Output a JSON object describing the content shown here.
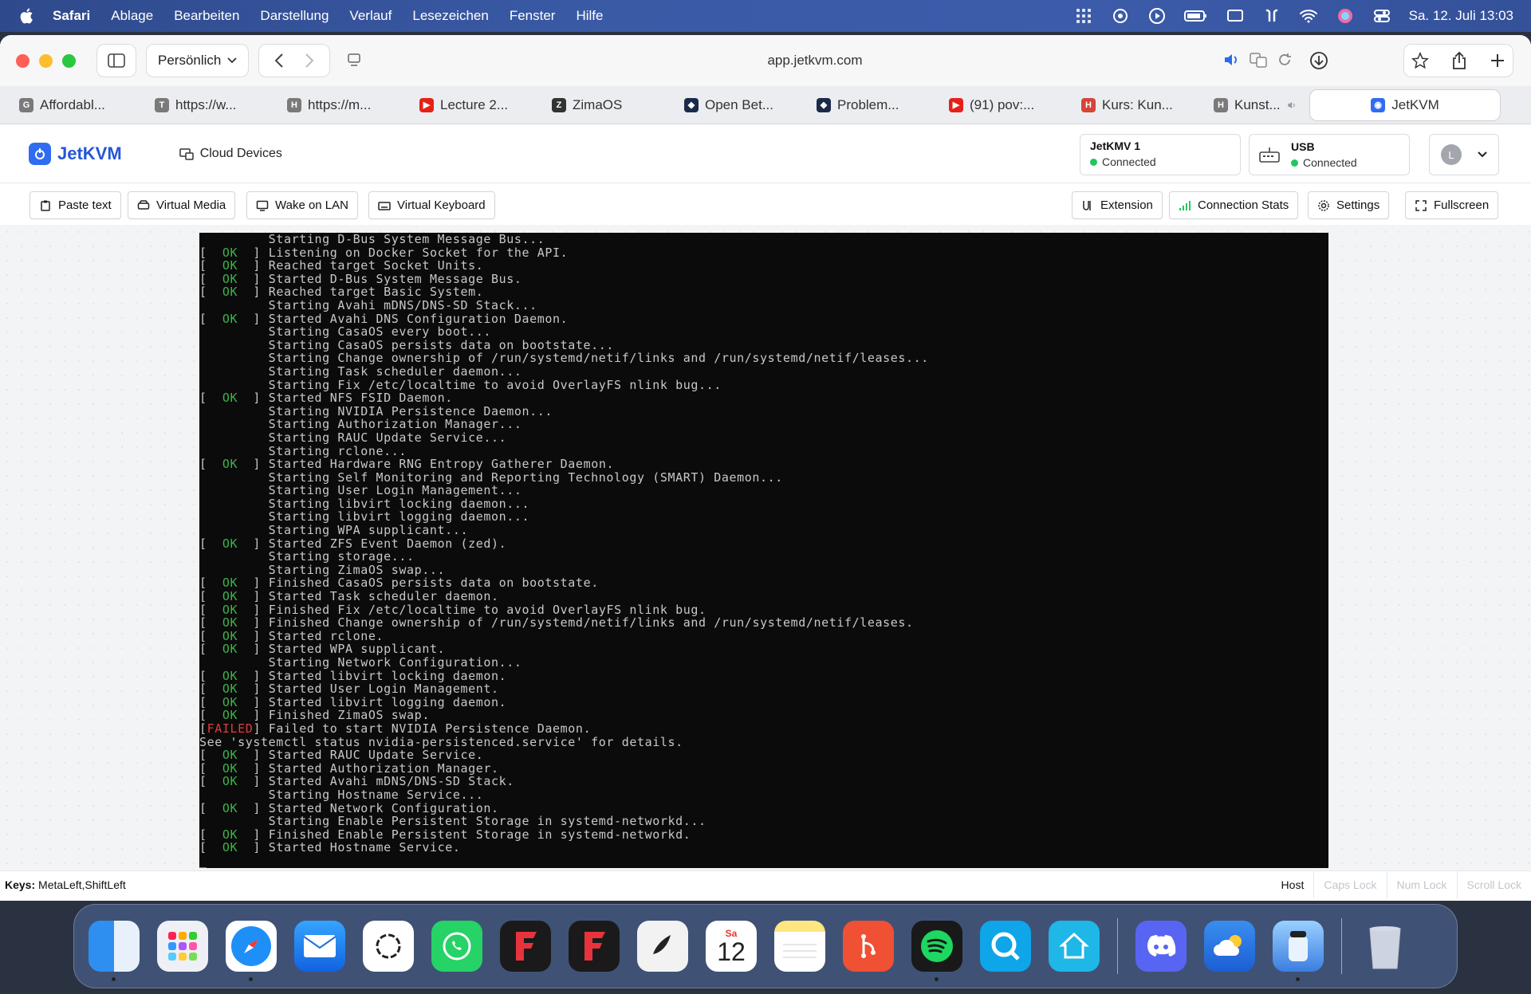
{
  "menubar": {
    "app": "Safari",
    "items": [
      "Ablage",
      "Bearbeiten",
      "Darstellung",
      "Verlauf",
      "Lesezeichen",
      "Fenster",
      "Hilfe"
    ],
    "clock": "Sa. 12. Juli  13:03"
  },
  "browser": {
    "profile": "Persönlich",
    "url": "app.jetkvm.com",
    "tabs": [
      {
        "label": "Affordabl...",
        "fav": "G",
        "color": "#7a7a7a"
      },
      {
        "label": "https://w...",
        "fav": "T",
        "color": "#7a7a7a"
      },
      {
        "label": "https://m...",
        "fav": "H",
        "color": "#7a7a7a"
      },
      {
        "label": "Lecture 2...",
        "fav": "▶",
        "color": "#e62117"
      },
      {
        "label": "ZimaOS",
        "fav": "Z",
        "color": "#333333"
      },
      {
        "label": "Open Bet...",
        "fav": "◆",
        "color": "#1c2a4a"
      },
      {
        "label": "Problem...",
        "fav": "◆",
        "color": "#1c2a4a"
      },
      {
        "label": "(91) pov:...",
        "fav": "▶",
        "color": "#e62117"
      },
      {
        "label": "Kurs: Kun...",
        "fav": "H",
        "color": "#d4453a"
      },
      {
        "label": "Kunst...",
        "fav": "H",
        "color": "#7a7a7a"
      },
      {
        "label": "JetKVM",
        "fav": "◉",
        "color": "#2f6cf0"
      }
    ]
  },
  "app": {
    "logo": "JetKVM",
    "cloud_devices": "Cloud Devices",
    "device": {
      "title": "JetKMV 1",
      "status": "Connected"
    },
    "usb": {
      "title": "USB",
      "status": "Connected"
    },
    "avatar": "L",
    "actions_left": [
      "Paste text",
      "Virtual Media",
      "Wake on LAN",
      "Virtual Keyboard"
    ],
    "actions_right": [
      "Extension",
      "Connection Stats",
      "Settings",
      "Fullscreen"
    ]
  },
  "console": {
    "lines": [
      {
        "tag": "",
        "text": "         Starting D-Bus System Message Bus..."
      },
      {
        "tag": "OK",
        "text": "Listening on Docker Socket for the API."
      },
      {
        "tag": "OK",
        "text": "Reached target Socket Units."
      },
      {
        "tag": "OK",
        "text": "Started D-Bus System Message Bus."
      },
      {
        "tag": "OK",
        "text": "Reached target Basic System."
      },
      {
        "tag": "",
        "text": "         Starting Avahi mDNS/DNS-SD Stack..."
      },
      {
        "tag": "OK",
        "text": "Started Avahi DNS Configuration Daemon."
      },
      {
        "tag": "",
        "text": "         Starting CasaOS every boot..."
      },
      {
        "tag": "",
        "text": "         Starting CasaOS persists data on bootstate..."
      },
      {
        "tag": "",
        "text": "         Starting Change ownership of /run/systemd/netif/links and /run/systemd/netif/leases..."
      },
      {
        "tag": "",
        "text": "         Starting Task scheduler daemon..."
      },
      {
        "tag": "",
        "text": "         Starting Fix /etc/localtime to avoid OverlayFS nlink bug..."
      },
      {
        "tag": "OK",
        "text": "Started NFS FSID Daemon."
      },
      {
        "tag": "",
        "text": "         Starting NVIDIA Persistence Daemon..."
      },
      {
        "tag": "",
        "text": "         Starting Authorization Manager..."
      },
      {
        "tag": "",
        "text": "         Starting RAUC Update Service..."
      },
      {
        "tag": "",
        "text": "         Starting rclone..."
      },
      {
        "tag": "OK",
        "text": "Started Hardware RNG Entropy Gatherer Daemon."
      },
      {
        "tag": "",
        "text": "         Starting Self Monitoring and Reporting Technology (SMART) Daemon..."
      },
      {
        "tag": "",
        "text": "         Starting User Login Management..."
      },
      {
        "tag": "",
        "text": "         Starting libvirt locking daemon..."
      },
      {
        "tag": "",
        "text": "         Starting libvirt logging daemon..."
      },
      {
        "tag": "",
        "text": "         Starting WPA supplicant..."
      },
      {
        "tag": "OK",
        "text": "Started ZFS Event Daemon (zed)."
      },
      {
        "tag": "",
        "text": "         Starting storage..."
      },
      {
        "tag": "",
        "text": "         Starting ZimaOS swap..."
      },
      {
        "tag": "OK",
        "text": "Finished CasaOS persists data on bootstate."
      },
      {
        "tag": "OK",
        "text": "Started Task scheduler daemon."
      },
      {
        "tag": "OK",
        "text": "Finished Fix /etc/localtime to avoid OverlayFS nlink bug."
      },
      {
        "tag": "OK",
        "text": "Finished Change ownership of /run/systemd/netif/links and /run/systemd/netif/leases."
      },
      {
        "tag": "OK",
        "text": "Started rclone."
      },
      {
        "tag": "OK",
        "text": "Started WPA supplicant."
      },
      {
        "tag": "",
        "text": "         Starting Network Configuration..."
      },
      {
        "tag": "OK",
        "text": "Started libvirt locking daemon."
      },
      {
        "tag": "OK",
        "text": "Started User Login Management."
      },
      {
        "tag": "OK",
        "text": "Started libvirt logging daemon."
      },
      {
        "tag": "OK",
        "text": "Finished ZimaOS swap."
      },
      {
        "tag": "FAILED",
        "text": "Failed to start NVIDIA Persistence Daemon."
      },
      {
        "tag": "",
        "text": "See 'systemctl status nvidia-persistenced.service' for details."
      },
      {
        "tag": "OK",
        "text": "Started RAUC Update Service."
      },
      {
        "tag": "OK",
        "text": "Started Authorization Manager."
      },
      {
        "tag": "OK",
        "text": "Started Avahi mDNS/DNS-SD Stack."
      },
      {
        "tag": "",
        "text": "         Starting Hostname Service..."
      },
      {
        "tag": "OK",
        "text": "Started Network Configuration."
      },
      {
        "tag": "",
        "text": "         Starting Enable Persistent Storage in systemd-networkd..."
      },
      {
        "tag": "OK",
        "text": "Finished Enable Persistent Storage in systemd-networkd."
      },
      {
        "tag": "OK",
        "text": "Started Hostname Service."
      }
    ]
  },
  "statusbar": {
    "keys_label": "Keys:",
    "keys_value": "MetaLeft,ShiftLeft",
    "host": "Host",
    "caps": "Caps Lock",
    "num": "Num Lock",
    "scroll": "Scroll Lock"
  },
  "dock": {
    "calendar_day": "Sa",
    "calendar_date": "12"
  }
}
